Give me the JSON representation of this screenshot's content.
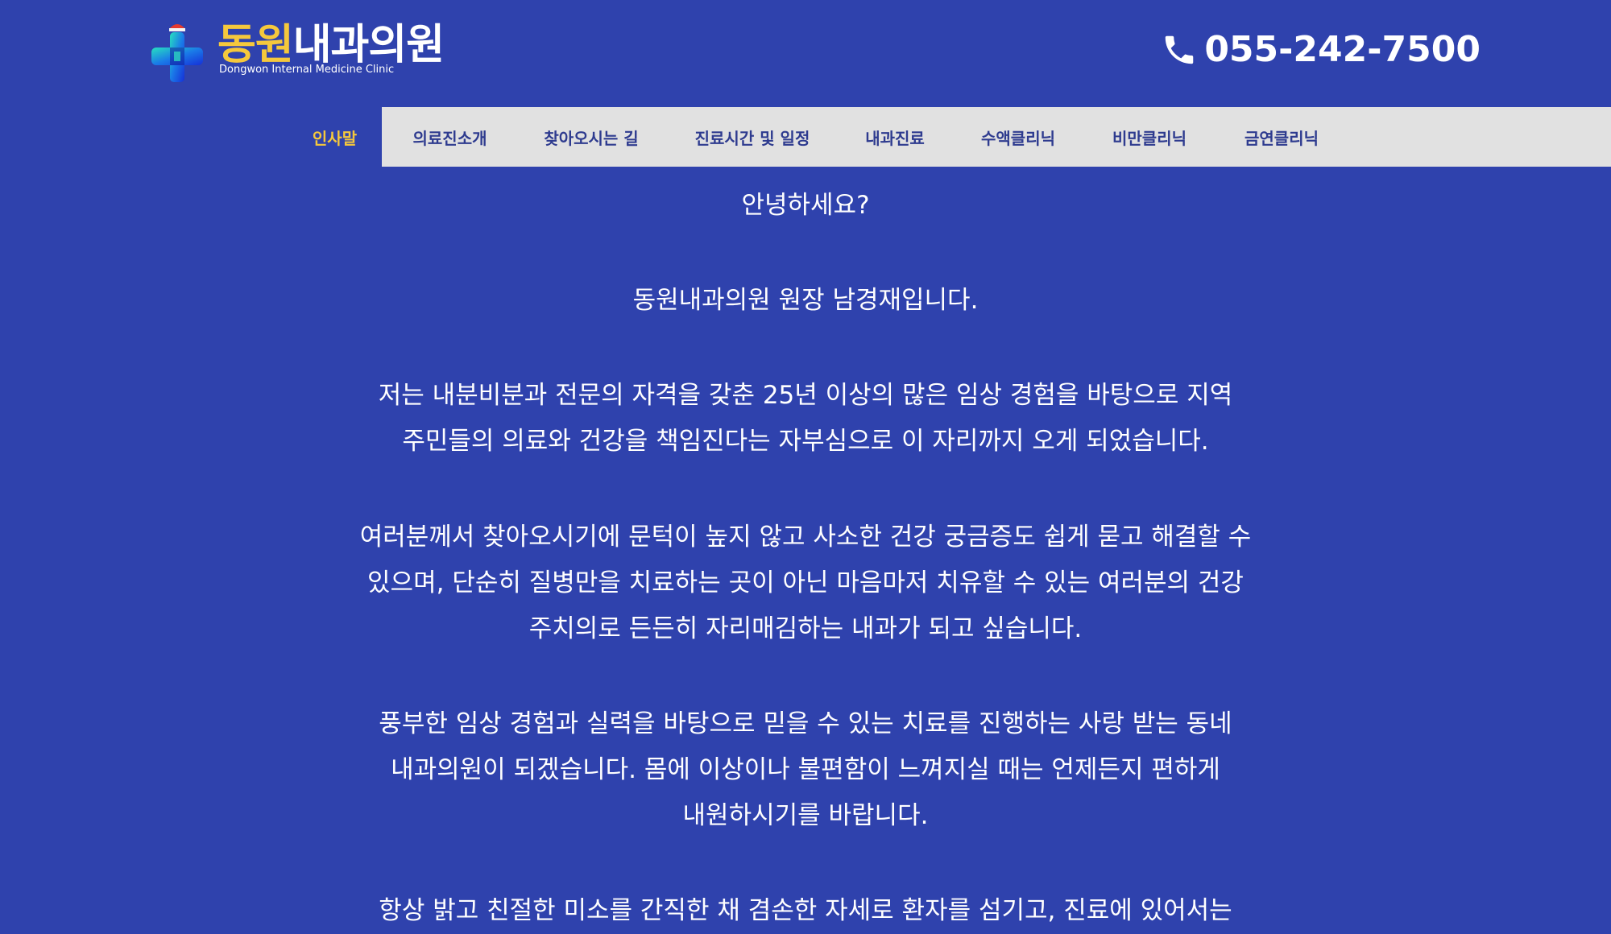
{
  "header": {
    "logo_title_part1": "동원",
    "logo_title_part2": "내과의원",
    "logo_subtitle": "Dongwon Internal Medicine Clinic",
    "phone_icon": "phone-icon",
    "phone_number": "055-242-7500"
  },
  "nav": {
    "items": [
      {
        "label": "인사말",
        "active": true
      },
      {
        "label": "의료진소개",
        "active": false
      },
      {
        "label": "찾아오시는 길",
        "active": false
      },
      {
        "label": "진료시간 및 일정",
        "active": false
      },
      {
        "label": "내과진료",
        "active": false
      },
      {
        "label": "수액클리닉",
        "active": false
      },
      {
        "label": "비만클리닉",
        "active": false
      },
      {
        "label": "금연클리닉",
        "active": false
      }
    ]
  },
  "greeting": {
    "lines": [
      "안녕하세요?",
      "동원내과의원 원장 남경재입니다.",
      "저는 내분비분과 전문의 자격을 갖춘 25년 이상의 많은 임상 경험을 바탕으로 지역",
      "주민들의 의료와 건강을 책임진다는 자부심으로 이 자리까지 오게 되었습니다.",
      "여러분께서 찾아오시기에 문턱이 높지 않고 사소한 건강 궁금증도 쉽게 묻고 해결할 수",
      "있으며, 단순히 질병만을 치료하는 곳이 아닌 마음마저 치유할 수 있는 여러분의 건강",
      "주치의로 든든히 자리매김하는 내과가 되고 싶습니다.",
      "풍부한 임상 경험과 실력을 바탕으로 믿을 수 있는 치료를 진행하는 사랑 받는 동네",
      "내과의원이 되겠습니다. 몸에 이상이나 불편함이 느껴지실 때는 언제든지 편하게",
      "내원하시기를 바랍니다.",
      "항상 밝고 친절한 미소를 간직한 채 겸손한 자세로 환자를 섬기고, 진료에 있어서는"
    ]
  },
  "colors": {
    "background": "#2f42ad",
    "nav_background": "#e1e1e1",
    "nav_text": "#2e3b8f",
    "accent_yellow": "#f5c83c",
    "text": "#ffffff"
  }
}
